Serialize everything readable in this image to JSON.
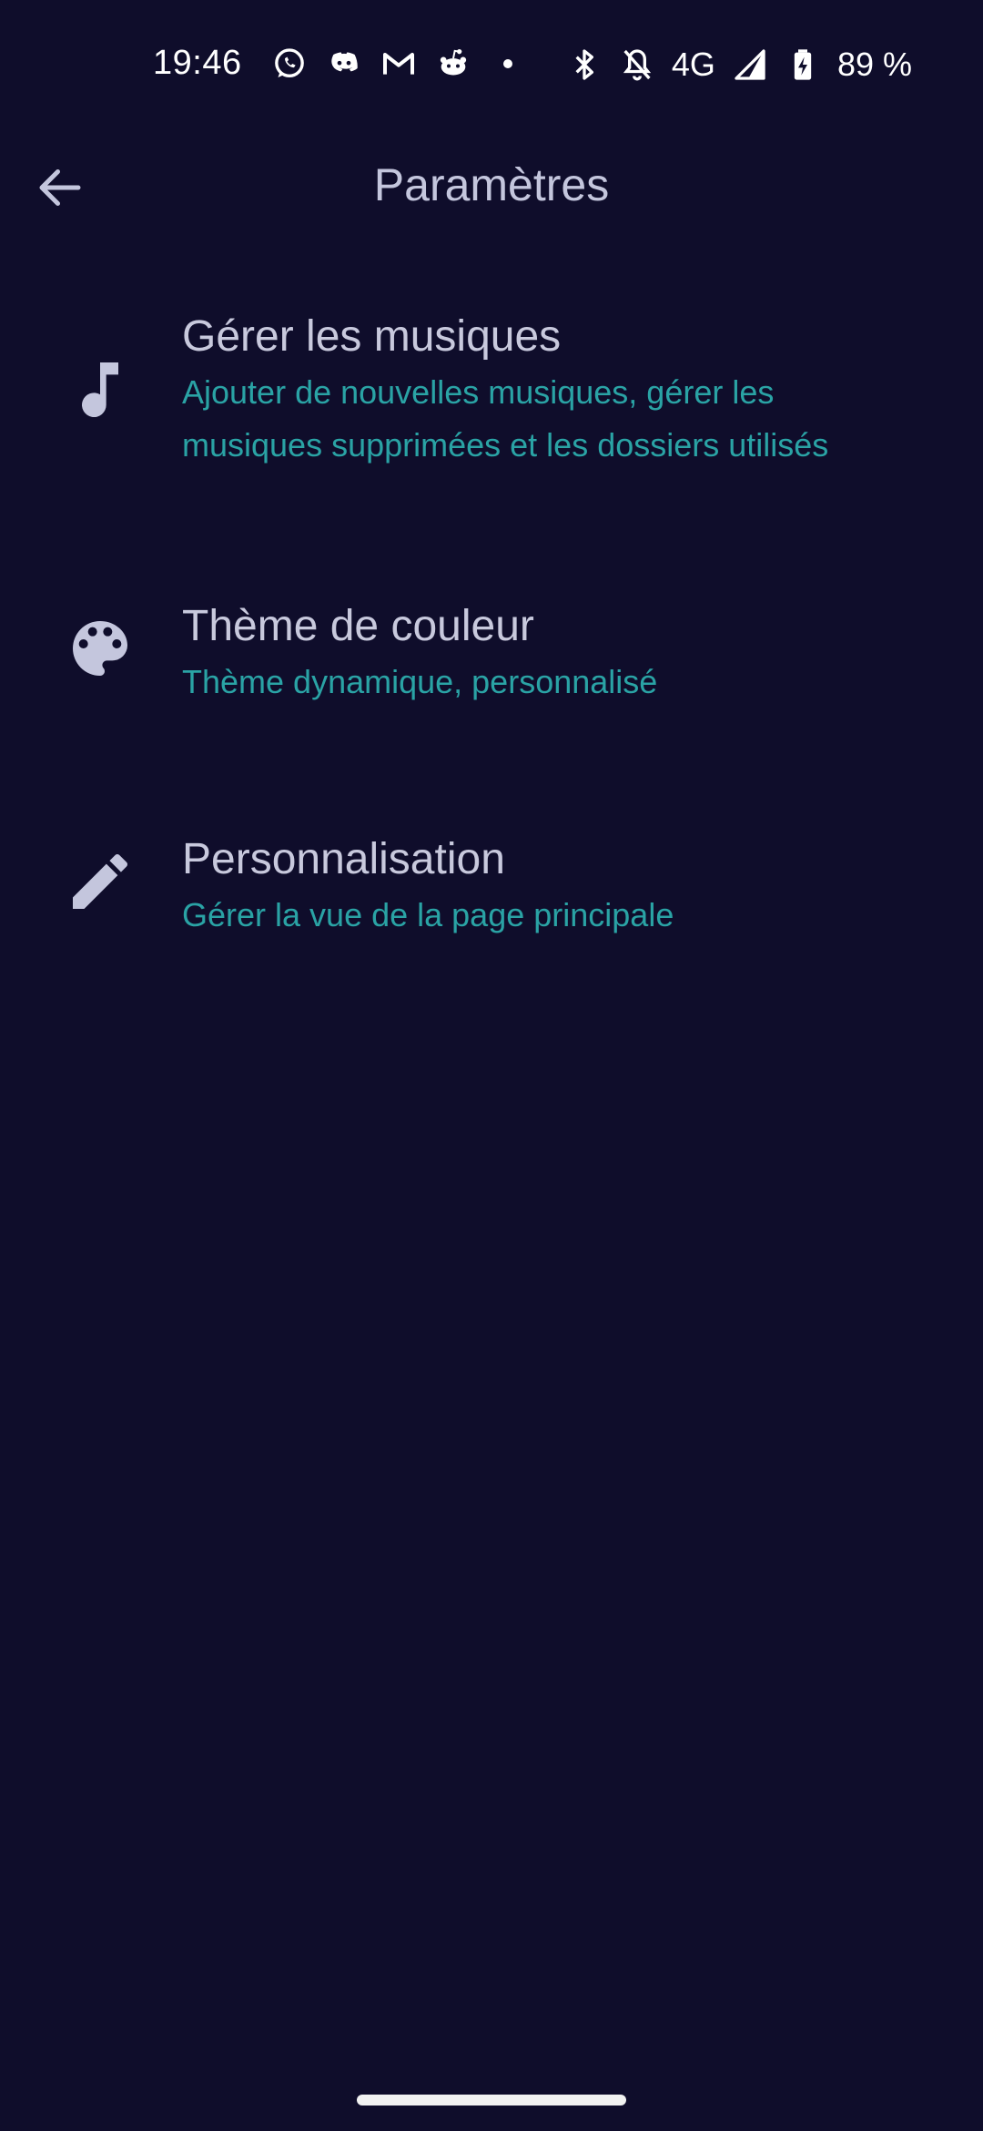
{
  "status_bar": {
    "time": "19:46",
    "left_icons": [
      "whatsapp-icon",
      "discord-icon",
      "gmail-icon",
      "reddit-icon",
      "more-notifications-dot-icon"
    ],
    "network": "4G",
    "battery": "89 %"
  },
  "app_bar": {
    "title": "Paramètres",
    "back_icon": "arrow-back-icon"
  },
  "settings": [
    {
      "icon": "music-note-icon",
      "title": "Gérer les musiques",
      "subtitle": "Ajouter de nouvelles musiques, gérer les musiques supprimées et les dossiers utilisés"
    },
    {
      "icon": "palette-icon",
      "title": "Thème de couleur",
      "subtitle": "Thème dynamique, personnalisé"
    },
    {
      "icon": "pencil-icon",
      "title": "Personnalisation",
      "subtitle": "Gérer la vue de la page principale"
    }
  ],
  "colors": {
    "background": "#0f0d2b",
    "title_text": "#c8c9dd",
    "subtitle_text": "#2aa3a5",
    "icon": "#c4c6dd"
  }
}
